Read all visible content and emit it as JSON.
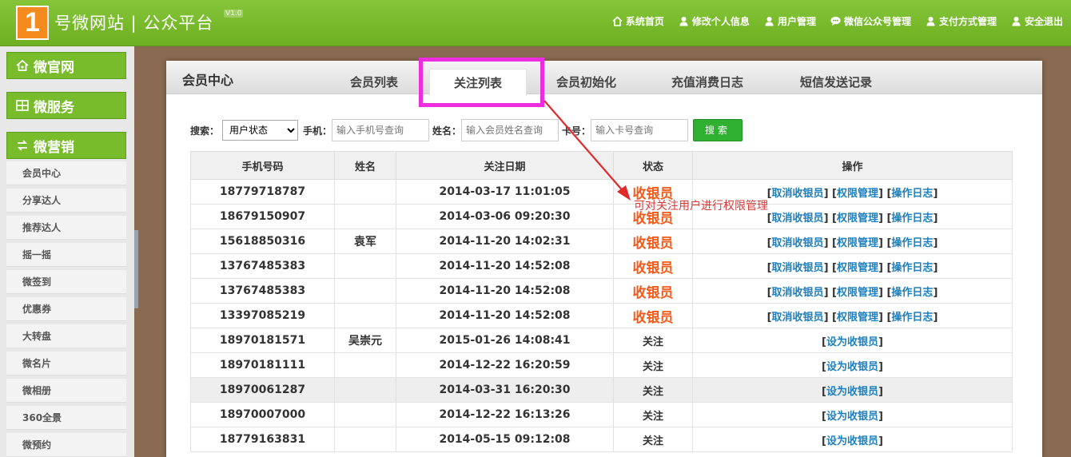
{
  "header": {
    "logo_digit": "1",
    "logo_text": "号微网站 | 公众平台",
    "version": "V1.0",
    "nav": [
      {
        "label": "系统首页",
        "icon": "home-icon"
      },
      {
        "label": "修改个人信息",
        "icon": "user-icon"
      },
      {
        "label": "用户管理",
        "icon": "user-icon"
      },
      {
        "label": "微信公众号管理",
        "icon": "chat-icon"
      },
      {
        "label": "支付方式管理",
        "icon": "user-icon"
      },
      {
        "label": "安全退出",
        "icon": "user-icon"
      }
    ]
  },
  "sidebar": {
    "sections": [
      {
        "label": "微官网",
        "icon": "house-icon"
      },
      {
        "label": "微服务",
        "icon": "grid-icon"
      },
      {
        "label": "微营销",
        "icon": "exchange-icon"
      }
    ],
    "items": [
      "会员中心",
      "分享达人",
      "推荐达人",
      "摇一摇",
      "微签到",
      "优惠券",
      "大转盘",
      "微名片",
      "微相册",
      "360全景",
      "微预约"
    ]
  },
  "panel": {
    "title": "会员中心",
    "tabs": [
      "会员列表",
      "关注列表",
      "会员初始化",
      "充值消费日志",
      "短信发送记录"
    ],
    "active_tab": "关注列表"
  },
  "search": {
    "label": "搜索：",
    "status_select": "用户状态",
    "phone_label": "手机：",
    "phone_placeholder": "输入手机号查询",
    "name_label": "姓名：",
    "name_placeholder": "输入会员姓名查询",
    "card_label": "卡号：",
    "card_placeholder": "输入卡号查询",
    "button": "搜索"
  },
  "table": {
    "columns": [
      "手机号码",
      "姓名",
      "关注日期",
      "状态",
      "操作"
    ],
    "op_labels": {
      "cancel": "取消收银员",
      "perm": "权限管理",
      "log": "操作日志",
      "set": "设为收银员"
    },
    "rows": [
      {
        "phone": "18779718787",
        "name": "",
        "date": "2014-03-17 11:01:05",
        "status": "收银员",
        "type": "cashier"
      },
      {
        "phone": "18679150907",
        "name": "",
        "date": "2014-03-06 09:20:30",
        "status": "收银员",
        "type": "cashier"
      },
      {
        "phone": "15618850316",
        "name": "袁军",
        "date": "2014-11-20 14:02:31",
        "status": "收银员",
        "type": "cashier"
      },
      {
        "phone": "13767485383",
        "name": "",
        "date": "2014-11-20 14:52:08",
        "status": "收银员",
        "type": "cashier"
      },
      {
        "phone": "13767485383",
        "name": "",
        "date": "2014-11-20 14:52:08",
        "status": "收银员",
        "type": "cashier"
      },
      {
        "phone": "13397085219",
        "name": "",
        "date": "2014-11-20 14:52:08",
        "status": "收银员",
        "type": "cashier"
      },
      {
        "phone": "18970181571",
        "name": "吴崇元",
        "date": "2015-01-26 14:08:41",
        "status": "关注",
        "type": "follow"
      },
      {
        "phone": "18970181111",
        "name": "",
        "date": "2014-12-22 16:20:59",
        "status": "关注",
        "type": "follow"
      },
      {
        "phone": "18970061287",
        "name": "",
        "date": "2014-03-31 16:20:30",
        "status": "关注",
        "type": "follow",
        "shade": true
      },
      {
        "phone": "18970007000",
        "name": "",
        "date": "2014-12-22 16:13:26",
        "status": "关注",
        "type": "follow"
      },
      {
        "phone": "18779163831",
        "name": "",
        "date": "2014-05-15 09:12:08",
        "status": "关注",
        "type": "follow"
      }
    ]
  },
  "annotation": {
    "text": "可对关注用户进行权限管理",
    "color": "#d83a3a"
  },
  "colors": {
    "brand_green": "#78bc2c",
    "highlight_magenta": "#ee2de0",
    "link_blue": "#1f7fbd",
    "cashier_orange": "#f25a1a"
  }
}
